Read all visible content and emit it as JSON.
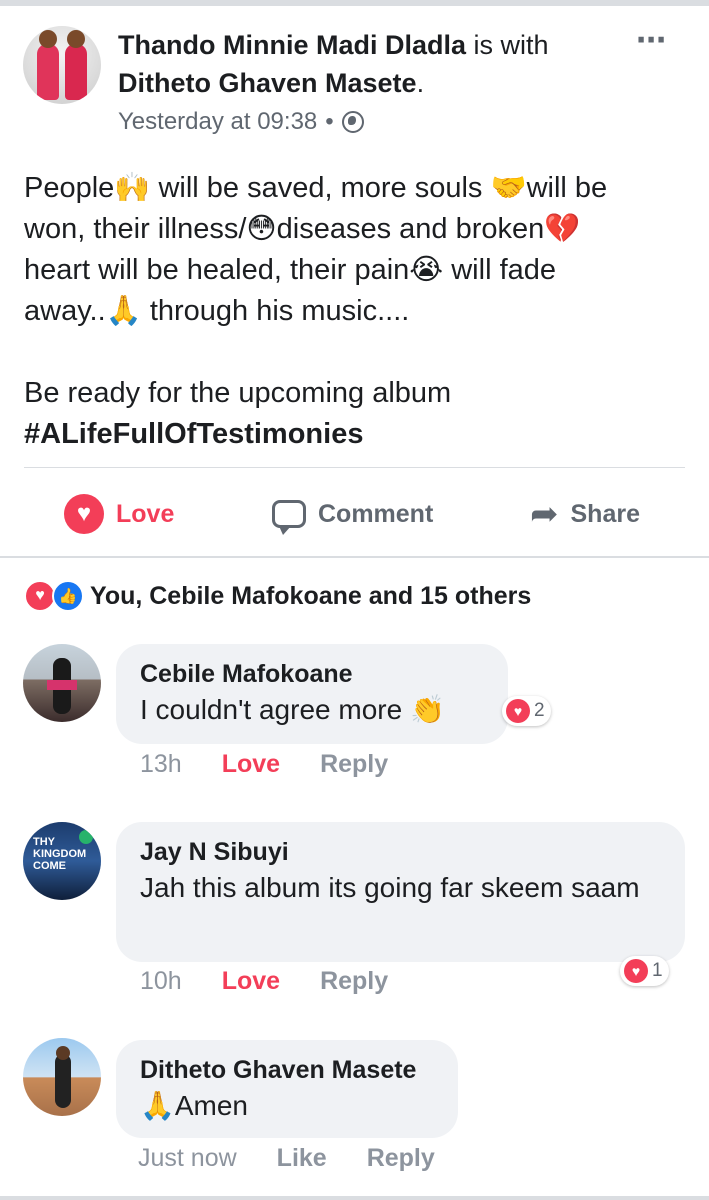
{
  "post": {
    "author": "Thando Minnie Madi Dladla",
    "with_text": " is with ",
    "tagged": "Ditheto Ghaven Masete",
    "period": ".",
    "timestamp": "Yesterday at 09:38",
    "separator": "•",
    "more_icon": "⋯",
    "text_lines": [
      "People🙌 will be saved,  more souls 🤝will be",
      "won, their illness/😳diseases and broken💔",
      "heart will be healed, their pain😭 will fade",
      "away..🙏 through his music...."
    ],
    "line_after": "Be ready for the upcoming album",
    "hashtag": "#ALifeFullOfTestimonies"
  },
  "actions": {
    "love_label": "Love",
    "comment_label": "Comment",
    "share_label": "Share"
  },
  "reactions": {
    "summary": "You, Cebile Mafokoane and 15 others"
  },
  "comments": [
    {
      "name": "Cebile Mafokoane",
      "text": "I couldn't agree more 👏",
      "time": "13h",
      "action1": "Love",
      "action2": "Reply",
      "reaction_count": "2"
    },
    {
      "name": "Jay N Sibuyi",
      "text": "Jah this album its going far skeem saam",
      "time": "10h",
      "action1": "Love",
      "action2": "Reply",
      "reaction_count": "1"
    },
    {
      "name": "Ditheto Ghaven Masete",
      "text": "🙏Amen",
      "time": "Just now",
      "action1": "Like",
      "action2": "Reply"
    }
  ],
  "avatar2_text": "THY KINGDOM COME",
  "icons": {
    "globe": "globe-icon",
    "heart": "heart-icon",
    "like": "thumbs-up-icon",
    "comment": "comment-icon",
    "share": "share-icon"
  },
  "colors": {
    "love": "#f33e58",
    "like": "#1877f2",
    "muted": "#606770",
    "bubble": "#f0f2f5"
  }
}
